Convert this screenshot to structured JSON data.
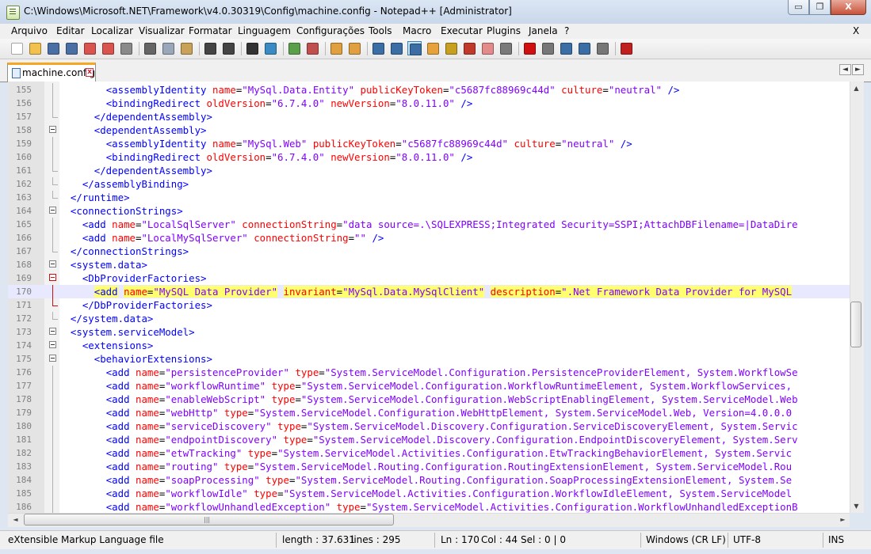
{
  "window": {
    "title": "C:\\Windows\\Microsoft.NET\\Framework\\v4.0.30319\\Config\\machine.config - Notepad++ [Administrator]",
    "min_glyph": "▭",
    "restore_glyph": "❐",
    "close_glyph": "X"
  },
  "menu": {
    "items": [
      "Arquivo",
      "Editar",
      "Localizar",
      "Visualizar",
      "Formatar",
      "Linguagem",
      "Configurações",
      "Tools",
      "Macro",
      "Executar",
      "Plugins",
      "Janela",
      "?"
    ],
    "close_glyph": "X"
  },
  "tabs": [
    {
      "label": "machine.config",
      "active": true
    }
  ],
  "tab_nav": {
    "left": "◄",
    "right": "►"
  },
  "colors": {
    "tag": "#0000ff",
    "attribute": "#ff0000",
    "string": "#8000ff",
    "current_line": "#e8e8ff",
    "match_highlight": "#ffff6f",
    "tab_accent": "#f5a623"
  },
  "editor": {
    "lines": [
      {
        "n": "155",
        "fold": "line",
        "text": "        <assemblyIdentity name=\"MySql.Data.Entity\" publicKeyToken=\"c5687fc88969c44d\" culture=\"neutral\" />"
      },
      {
        "n": "156",
        "fold": "line",
        "text": "        <bindingRedirect oldVersion=\"6.7.4.0\" newVersion=\"8.0.11.0\" />"
      },
      {
        "n": "157",
        "fold": "end",
        "text": "      </dependentAssembly>"
      },
      {
        "n": "158",
        "fold": "box",
        "text": "      <dependentAssembly>"
      },
      {
        "n": "159",
        "fold": "line",
        "text": "        <assemblyIdentity name=\"MySql.Web\" publicKeyToken=\"c5687fc88969c44d\" culture=\"neutral\" />"
      },
      {
        "n": "160",
        "fold": "line",
        "text": "        <bindingRedirect oldVersion=\"6.7.4.0\" newVersion=\"8.0.11.0\" />"
      },
      {
        "n": "161",
        "fold": "end",
        "text": "      </dependentAssembly>"
      },
      {
        "n": "162",
        "fold": "end",
        "text": "    </assemblyBinding>"
      },
      {
        "n": "163",
        "fold": "end",
        "text": "  </runtime>"
      },
      {
        "n": "164",
        "fold": "box",
        "text": "  <connectionStrings>"
      },
      {
        "n": "165",
        "fold": "line",
        "text": "    <add name=\"LocalSqlServer\" connectionString=\"data source=.\\SQLEXPRESS;Integrated Security=SSPI;AttachDBFilename=|DataDire"
      },
      {
        "n": "166",
        "fold": "line",
        "text": "    <add name=\"LocalMySqlServer\" connectionString=\"\" />"
      },
      {
        "n": "167",
        "fold": "end",
        "text": "  </connectionStrings>"
      },
      {
        "n": "168",
        "fold": "box",
        "text": "  <system.data>"
      },
      {
        "n": "169",
        "fold": "boxred",
        "text": "    <DbProviderFactories>"
      },
      {
        "n": "170",
        "fold": "linered",
        "current": true,
        "text": "      <add name=\"MySQL Data Provider\" invariant=\"MySql.Data.MySqlClient\" description=\".Net Framework Data Provider for MySQL"
      },
      {
        "n": "171",
        "fold": "endred",
        "text": "    </DbProviderFactories>"
      },
      {
        "n": "172",
        "fold": "end",
        "text": "  </system.data>"
      },
      {
        "n": "173",
        "fold": "box",
        "text": "  <system.serviceModel>"
      },
      {
        "n": "174",
        "fold": "box",
        "text": "    <extensions>"
      },
      {
        "n": "175",
        "fold": "box",
        "text": "      <behaviorExtensions>"
      },
      {
        "n": "176",
        "fold": "line",
        "text": "        <add name=\"persistenceProvider\" type=\"System.ServiceModel.Configuration.PersistenceProviderElement, System.WorkflowSe"
      },
      {
        "n": "177",
        "fold": "line",
        "text": "        <add name=\"workflowRuntime\" type=\"System.ServiceModel.Configuration.WorkflowRuntimeElement, System.WorkflowServices,"
      },
      {
        "n": "178",
        "fold": "line",
        "text": "        <add name=\"enableWebScript\" type=\"System.ServiceModel.Configuration.WebScriptEnablingElement, System.ServiceModel.Web"
      },
      {
        "n": "179",
        "fold": "line",
        "text": "        <add name=\"webHttp\" type=\"System.ServiceModel.Configuration.WebHttpElement, System.ServiceModel.Web, Version=4.0.0.0"
      },
      {
        "n": "180",
        "fold": "line",
        "text": "        <add name=\"serviceDiscovery\" type=\"System.ServiceModel.Discovery.Configuration.ServiceDiscoveryElement, System.Servic"
      },
      {
        "n": "181",
        "fold": "line",
        "text": "        <add name=\"endpointDiscovery\" type=\"System.ServiceModel.Discovery.Configuration.EndpointDiscoveryElement, System.Serv"
      },
      {
        "n": "182",
        "fold": "line",
        "text": "        <add name=\"etwTracking\" type=\"System.ServiceModel.Activities.Configuration.EtwTrackingBehaviorElement, System.Servic"
      },
      {
        "n": "183",
        "fold": "line",
        "text": "        <add name=\"routing\" type=\"System.ServiceModel.Routing.Configuration.RoutingExtensionElement, System.ServiceModel.Rou"
      },
      {
        "n": "184",
        "fold": "line",
        "text": "        <add name=\"soapProcessing\" type=\"System.ServiceModel.Routing.Configuration.SoapProcessingExtensionElement, System.Se"
      },
      {
        "n": "185",
        "fold": "line",
        "text": "        <add name=\"workflowIdle\" type=\"System.ServiceModel.Activities.Configuration.WorkflowIdleElement, System.ServiceModel"
      },
      {
        "n": "186",
        "fold": "line",
        "text": "        <add name=\"workflowUnhandledException\" type=\"System.ServiceModel.Activities.Configuration.WorkflowUnhandledExceptionB"
      }
    ]
  },
  "toolbar": {
    "icons": [
      {
        "name": "new-file-icon",
        "color": "#ffffff"
      },
      {
        "name": "open-file-icon",
        "color": "#f2c14e"
      },
      {
        "name": "save-icon",
        "color": "#4a6fa5"
      },
      {
        "name": "save-all-icon",
        "color": "#4a6fa5"
      },
      {
        "name": "close-file-icon",
        "color": "#d9534f"
      },
      {
        "name": "close-all-icon",
        "color": "#d9534f"
      },
      {
        "name": "print-icon",
        "color": "#8a8a8a"
      },
      {
        "sep": true
      },
      {
        "name": "cut-icon",
        "color": "#666666"
      },
      {
        "name": "copy-icon",
        "color": "#9aa7b8"
      },
      {
        "name": "paste-icon",
        "color": "#c9a25a"
      },
      {
        "sep": true
      },
      {
        "name": "undo-icon",
        "color": "#444444"
      },
      {
        "name": "redo-icon",
        "color": "#444444"
      },
      {
        "sep": true
      },
      {
        "name": "find-icon",
        "color": "#333333"
      },
      {
        "name": "replace-icon",
        "color": "#3a8bc4"
      },
      {
        "sep": true
      },
      {
        "name": "zoom-in-icon",
        "color": "#5aa04a"
      },
      {
        "name": "zoom-out-icon",
        "color": "#c0504d"
      },
      {
        "sep": true
      },
      {
        "name": "sync-vertical-icon",
        "color": "#e0a040"
      },
      {
        "name": "sync-horizontal-icon",
        "color": "#e0a040"
      },
      {
        "sep": true
      },
      {
        "name": "word-wrap-icon",
        "color": "#3a6ea5"
      },
      {
        "name": "show-all-chars-icon",
        "color": "#3a6ea5"
      },
      {
        "name": "indent-guide-icon",
        "color": "#3a6ea5",
        "active": true
      },
      {
        "name": "user-language-icon",
        "color": "#e7a23c"
      },
      {
        "name": "document-map-icon",
        "color": "#c8a020"
      },
      {
        "name": "function-list-icon",
        "color": "#c0392b"
      },
      {
        "name": "folder-workspace-icon",
        "color": "#e38a8a"
      },
      {
        "name": "monitoring-icon",
        "color": "#7a7a7a"
      },
      {
        "sep": true
      },
      {
        "name": "record-macro-icon",
        "color": "#d01010"
      },
      {
        "name": "stop-record-icon",
        "color": "#777777"
      },
      {
        "name": "play-macro-icon",
        "color": "#3a6ea5"
      },
      {
        "name": "run-macro-multiple-icon",
        "color": "#3a6ea5"
      },
      {
        "name": "save-macro-icon",
        "color": "#777777"
      },
      {
        "sep": true
      },
      {
        "name": "spell-check-icon",
        "color": "#c02020"
      }
    ]
  },
  "scrollbars": {
    "up": "▲",
    "down": "▼",
    "left": "◄",
    "right": "►",
    "grip": "|||"
  },
  "status": {
    "file_type": "eXtensible Markup Language file",
    "length": "length : 37.631",
    "lines": "lines : 295",
    "ln": "Ln : 170",
    "col": "Col : 44",
    "sel": "Sel : 0 | 0",
    "eol": "Windows (CR LF)",
    "encoding": "UTF-8",
    "mode": "INS"
  }
}
